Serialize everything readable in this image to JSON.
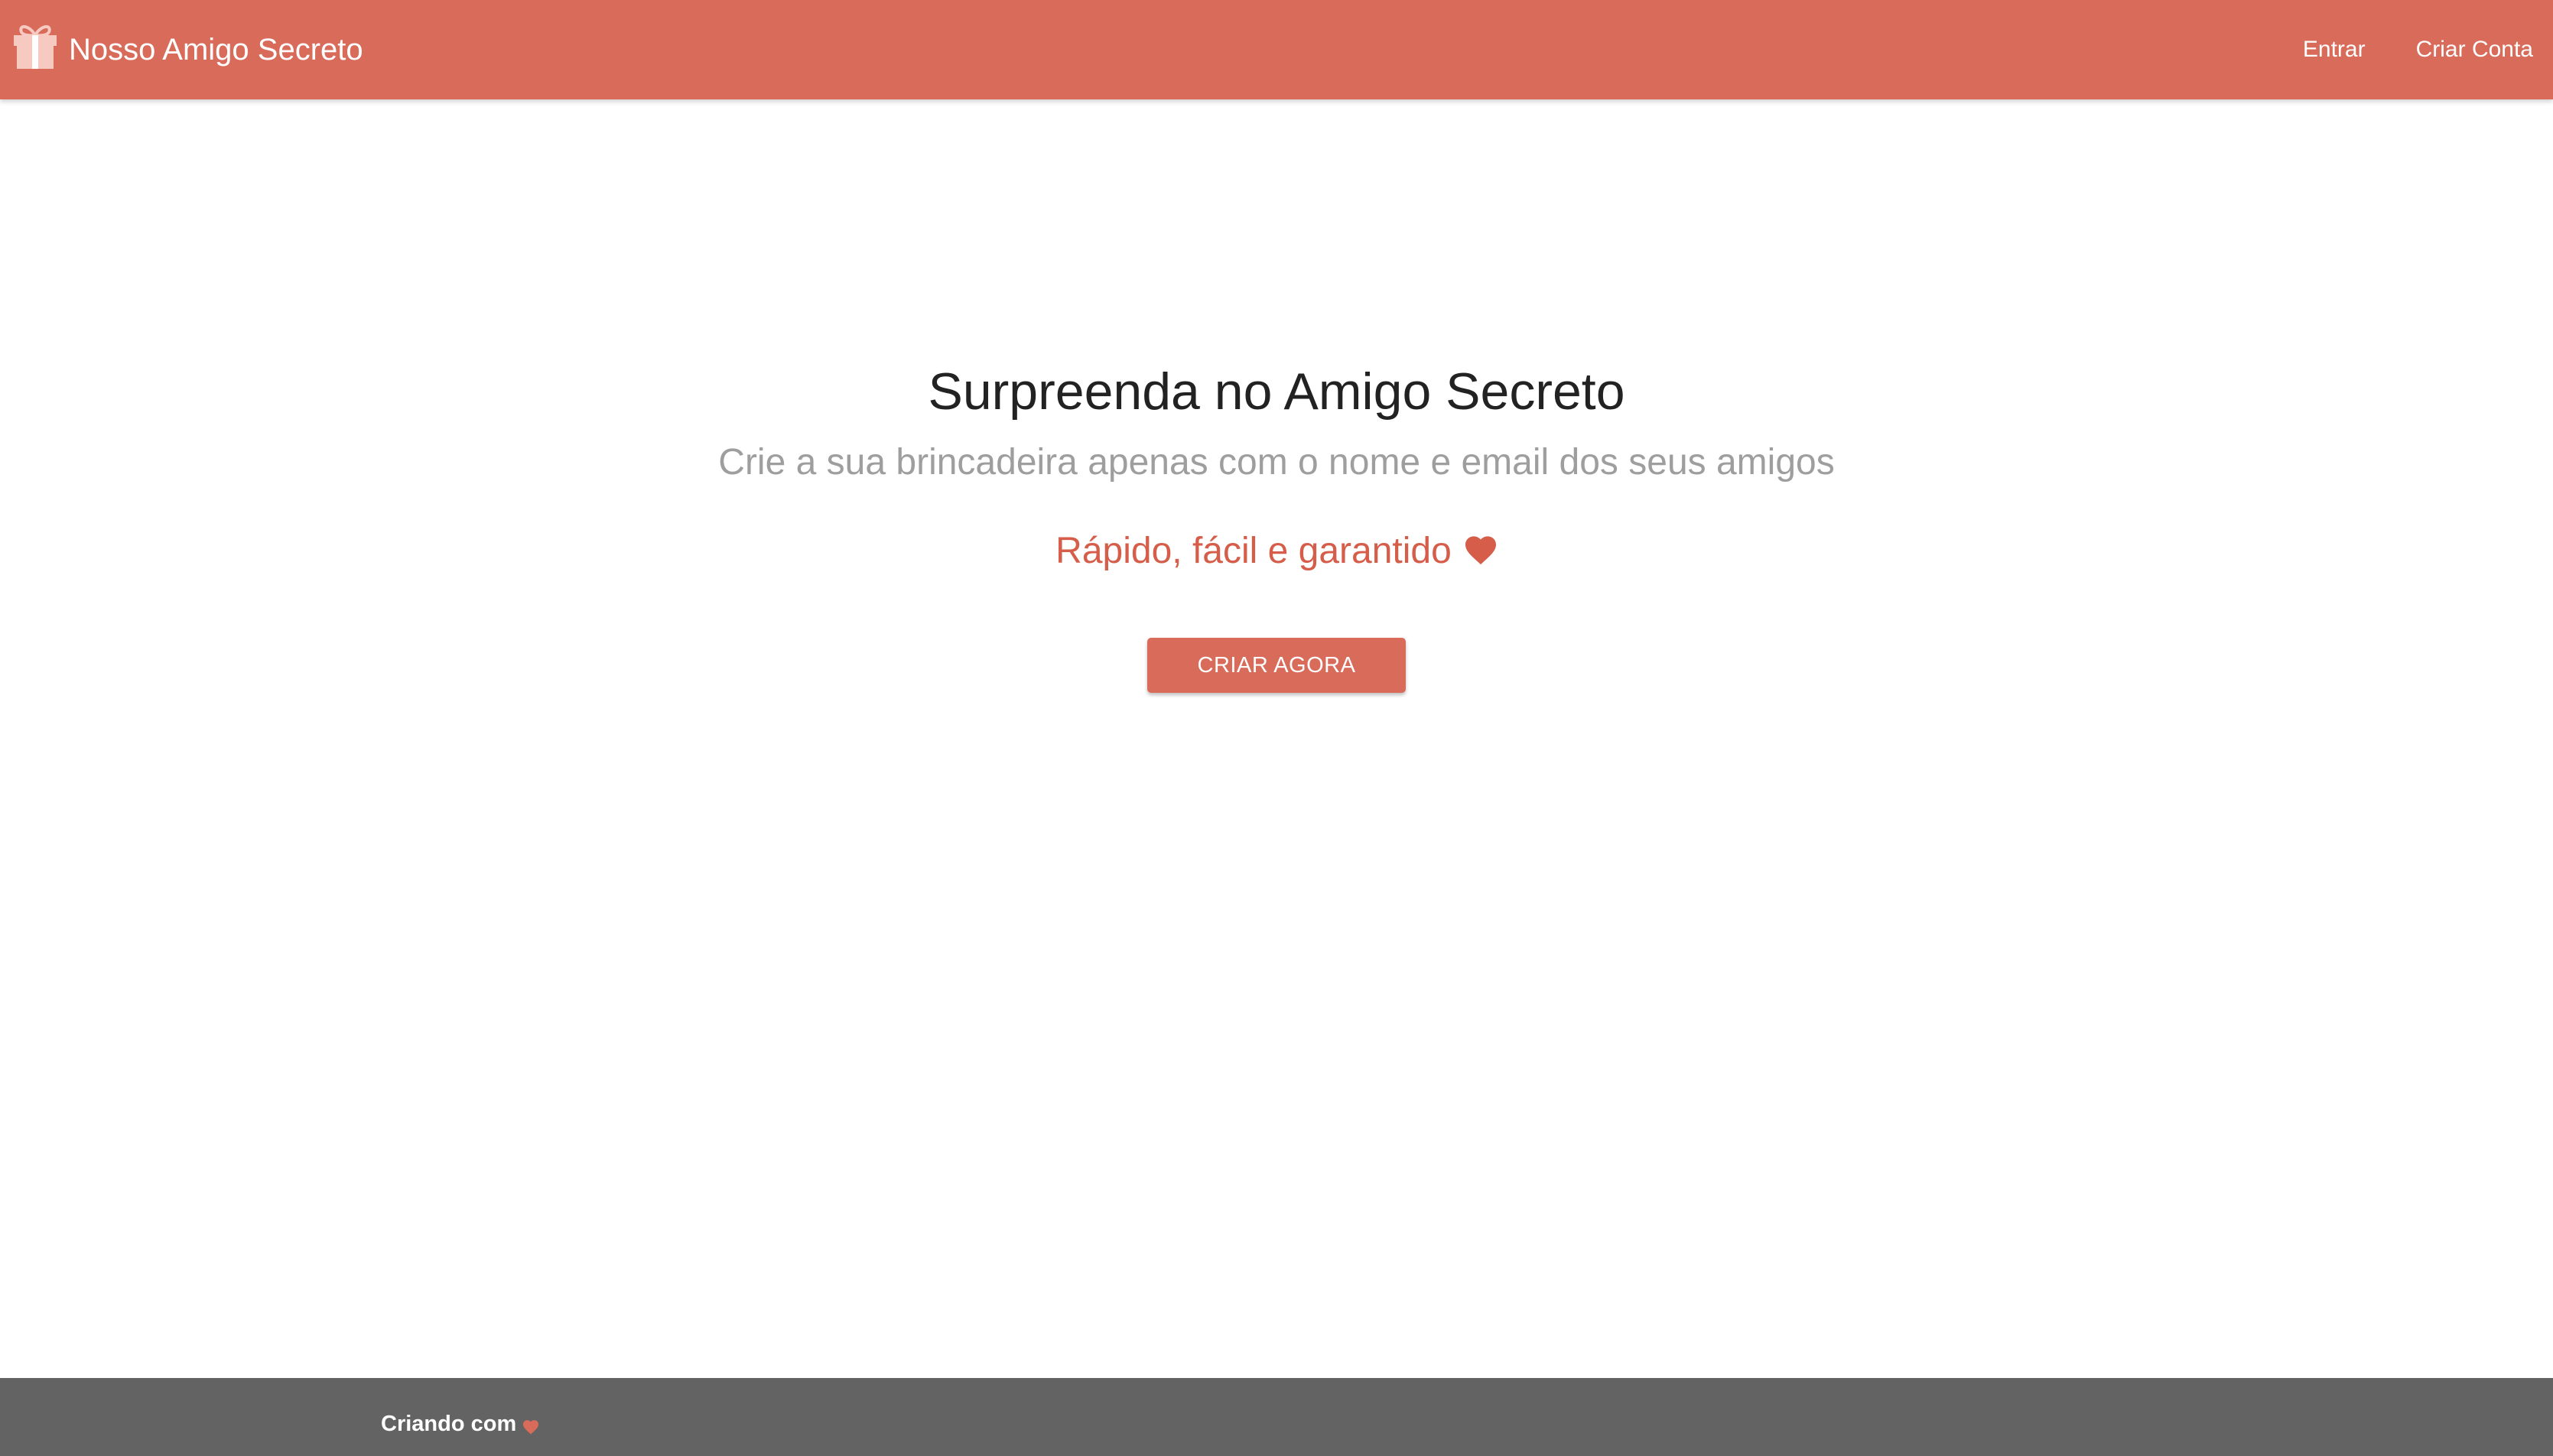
{
  "colors": {
    "accent": "#d96b5a",
    "tagline": "#d55d4a",
    "footer_bg": "#636363",
    "subtitle": "#9e9e9e",
    "title": "#222222"
  },
  "navbar": {
    "brand_icon": "gift-icon",
    "brand_label": "Nosso Amigo Secreto",
    "links": [
      {
        "label": "Entrar"
      },
      {
        "label": "Criar Conta"
      }
    ]
  },
  "hero": {
    "title": "Surpreenda no Amigo Secreto",
    "subtitle": "Crie a sua brincadeira apenas com o nome e email dos seus amigos",
    "tagline": "Rápido, fácil e garantido",
    "tagline_icon": "heart-icon",
    "cta_label": "CRIAR AGORA"
  },
  "footer": {
    "text": "Criando com",
    "icon": "heart-icon"
  }
}
